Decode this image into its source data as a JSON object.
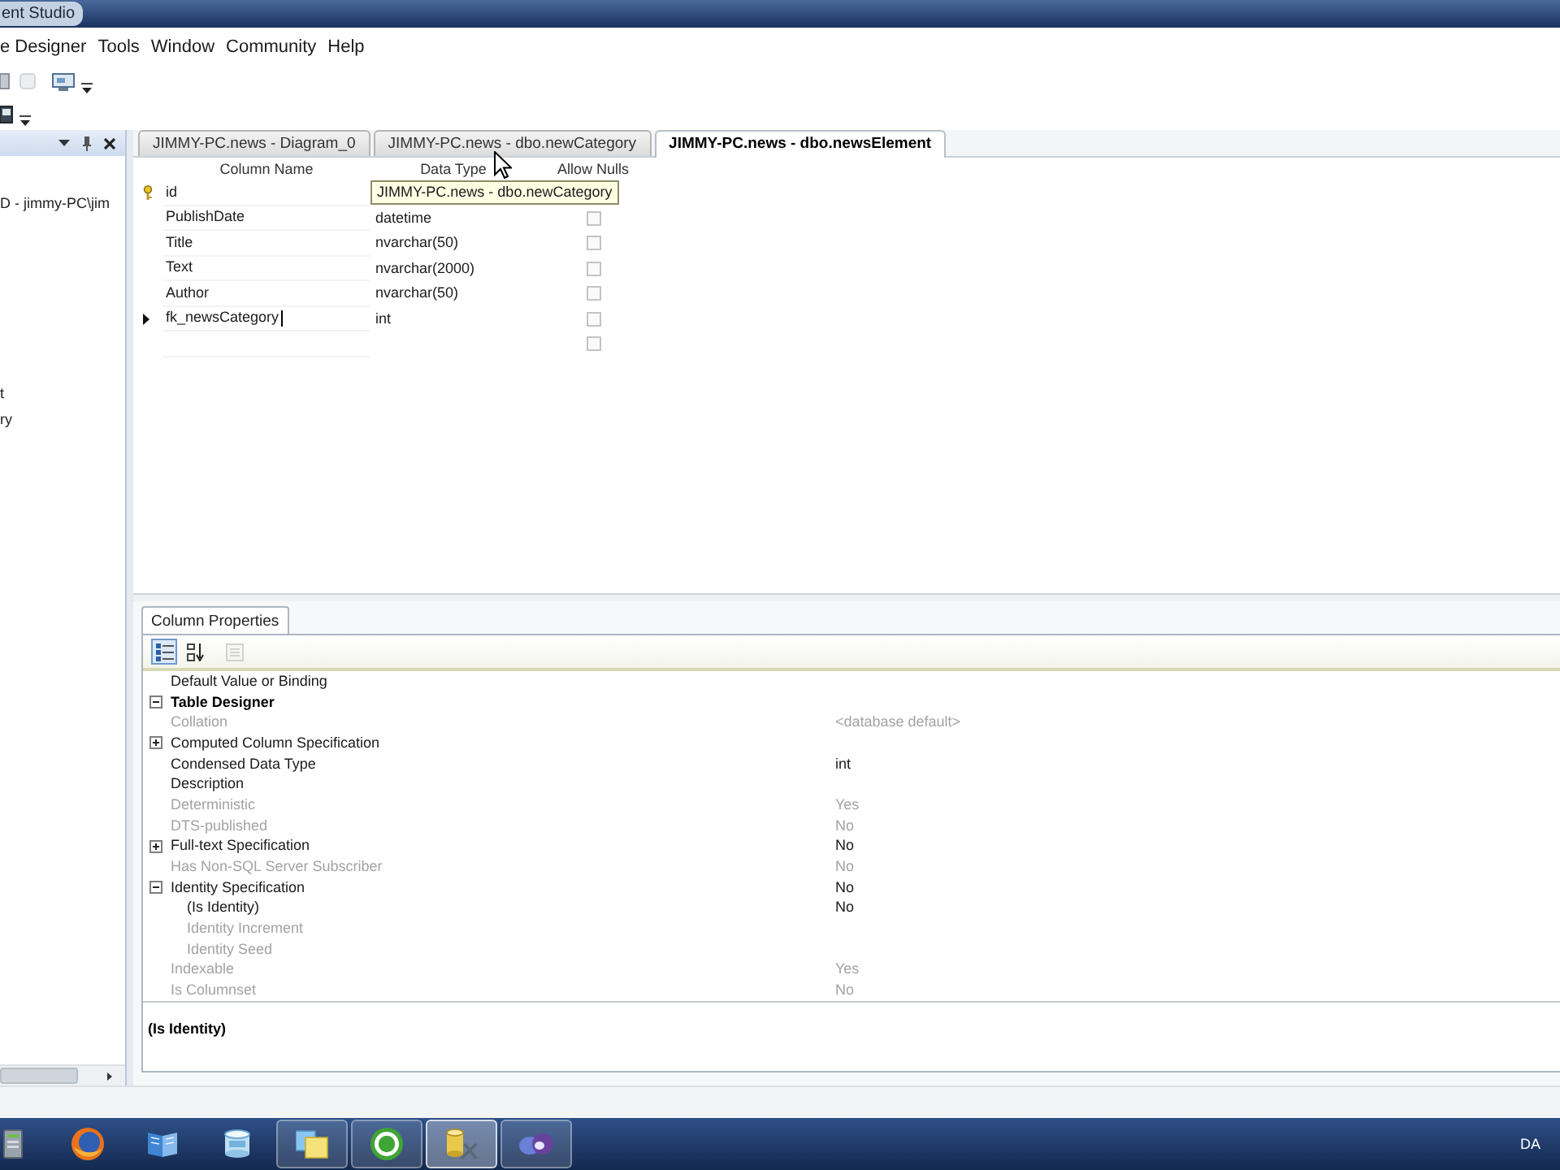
{
  "window": {
    "title": "ent Studio"
  },
  "menu": [
    "e Designer",
    "Tools",
    "Window",
    "Community",
    "Help"
  ],
  "explorer": {
    "items": [
      "D - jimmy-PC\\jim",
      "t",
      "ry"
    ]
  },
  "tabs": [
    {
      "label": "JIMMY-PC.news - Diagram_0",
      "selected": false
    },
    {
      "label": "JIMMY-PC.news - dbo.newCategory",
      "selected": false
    },
    {
      "label": "JIMMY-PC.news - dbo.newsElement",
      "selected": true
    }
  ],
  "tooltip": "JIMMY-PC.news - dbo.newCategory",
  "grid": {
    "columns": [
      "Column Name",
      "Data Type",
      "Allow Nulls"
    ],
    "rows": [
      {
        "name": "id",
        "primary_key": true,
        "current": false,
        "editing": false
      },
      {
        "name": "PublishDate",
        "data_type": "datetime",
        "allow_nulls": false,
        "primary_key": false,
        "current": false,
        "editing": false
      },
      {
        "name": "Title",
        "data_type": "nvarchar(50)",
        "allow_nulls": false,
        "primary_key": false,
        "current": false,
        "editing": false
      },
      {
        "name": "Text",
        "data_type": "nvarchar(2000)",
        "allow_nulls": false,
        "primary_key": false,
        "current": false,
        "editing": false
      },
      {
        "name": "Author",
        "data_type": "nvarchar(50)",
        "allow_nulls": false,
        "primary_key": false,
        "current": false,
        "editing": false
      },
      {
        "name": "fk_newsCategory",
        "data_type": "int",
        "allow_nulls": false,
        "primary_key": false,
        "current": true,
        "editing": true
      },
      {
        "allow_nulls": false,
        "primary_key": false,
        "current": false,
        "editing": false
      }
    ]
  },
  "properties": {
    "tab": "Column Properties",
    "toolbar": [
      {
        "kind": "categorized",
        "selected": true,
        "disabled": false
      },
      {
        "kind": "alphabetical",
        "selected": false,
        "disabled": false
      },
      {
        "kind": "property_pages",
        "selected": false,
        "disabled": true
      }
    ],
    "rows": [
      {
        "kind": "property",
        "label": "Default Value or Binding",
        "disabled": false
      },
      {
        "kind": "category",
        "label": "Table Designer",
        "expanded": true,
        "children": [
          {
            "kind": "property",
            "label": "Collation",
            "value": "<database default>",
            "disabled": true
          },
          {
            "kind": "property",
            "label": "Computed Column Specification",
            "disabled": false,
            "expanded": false
          },
          {
            "kind": "property",
            "label": "Condensed Data Type",
            "value": "int",
            "disabled": false
          },
          {
            "kind": "property",
            "label": "Description",
            "disabled": false
          },
          {
            "kind": "property",
            "label": "Deterministic",
            "value": "Yes",
            "disabled": true
          },
          {
            "kind": "property",
            "label": "DTS-published",
            "value": "No",
            "disabled": true
          },
          {
            "kind": "property",
            "label": "Full-text Specification",
            "value": "No",
            "disabled": false,
            "expanded": false
          },
          {
            "kind": "property",
            "label": "Has Non-SQL Server Subscriber",
            "value": "No",
            "disabled": true
          },
          {
            "kind": "property",
            "label": "Identity Specification",
            "value": "No",
            "disabled": false,
            "expanded": true,
            "children": [
              {
                "kind": "property",
                "label": "(Is Identity)",
                "value": "No",
                "disabled": false
              },
              {
                "kind": "property",
                "label": "Identity Increment",
                "disabled": true
              },
              {
                "kind": "property",
                "label": "Identity Seed",
                "disabled": true
              }
            ]
          },
          {
            "kind": "property",
            "label": "Indexable",
            "value": "Yes",
            "disabled": true
          },
          {
            "kind": "property",
            "label": "Is Columnset",
            "value": "No",
            "disabled": true
          }
        ]
      }
    ],
    "description": "(Is Identity)"
  },
  "taskbar": {
    "apps": [
      {
        "running": false,
        "active": false
      },
      {
        "running": false,
        "active": false
      },
      {
        "running": false,
        "active": false
      },
      {
        "running": false,
        "active": false
      },
      {
        "running": true,
        "active": false
      },
      {
        "running": true,
        "active": false
      },
      {
        "running": true,
        "active": true
      },
      {
        "running": true,
        "active": false
      }
    ],
    "language": "DA"
  }
}
